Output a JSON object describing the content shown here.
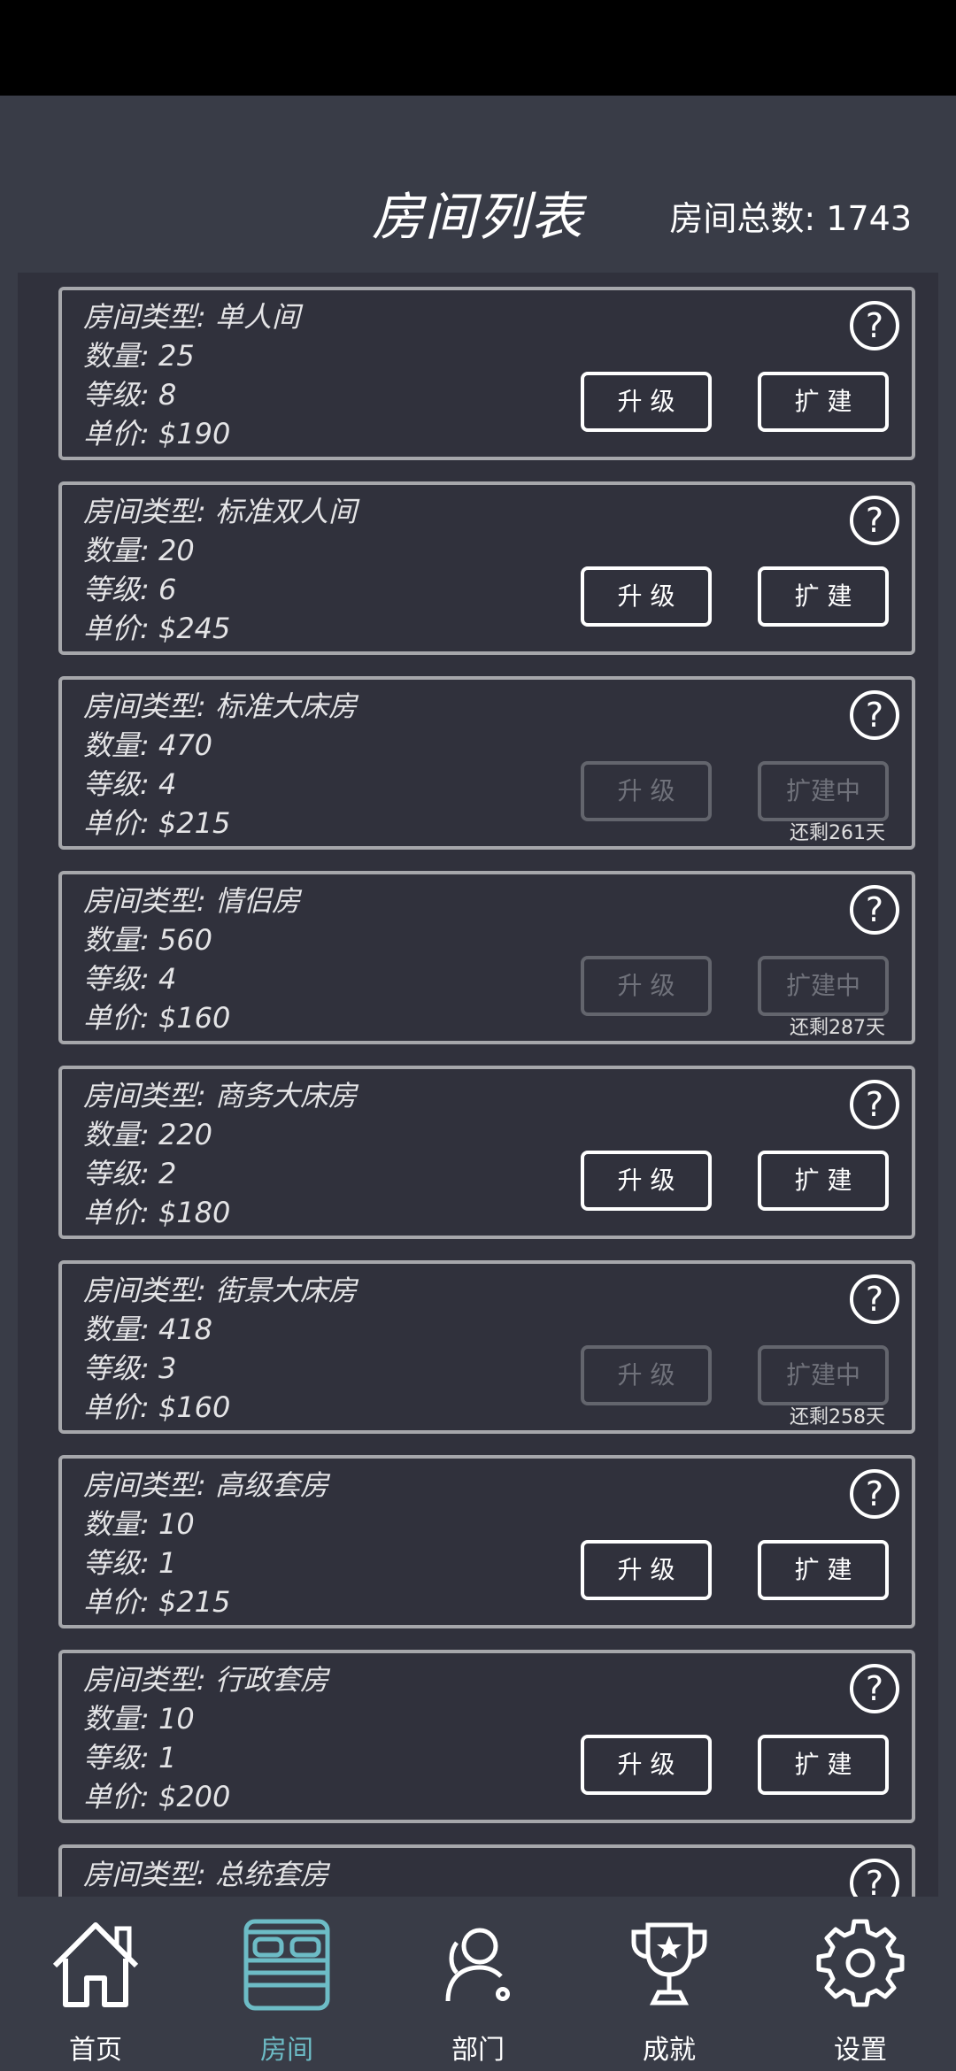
{
  "header": {
    "title": "房间列表",
    "total_label": "房间总数: 1743"
  },
  "buttons": {
    "upgrade": "升 级",
    "expand": "扩 建",
    "expanding": "扩建中",
    "help": "?"
  },
  "rooms": [
    {
      "type": "房间类型: 单人间",
      "count": "数量: 25",
      "level": "等级: 8",
      "price": "单价: $190",
      "state": "active",
      "remaining": ""
    },
    {
      "type": "房间类型: 标准双人间",
      "count": "数量: 20",
      "level": "等级: 6",
      "price": "单价: $245",
      "state": "active",
      "remaining": ""
    },
    {
      "type": "房间类型: 标准大床房",
      "count": "数量: 470",
      "level": "等级: 4",
      "price": "单价: $215",
      "state": "building",
      "remaining": "还剩261天"
    },
    {
      "type": "房间类型: 情侣房",
      "count": "数量: 560",
      "level": "等级: 4",
      "price": "单价: $160",
      "state": "building",
      "remaining": "还剩287天"
    },
    {
      "type": "房间类型: 商务大床房",
      "count": "数量: 220",
      "level": "等级: 2",
      "price": "单价: $180",
      "state": "active",
      "remaining": ""
    },
    {
      "type": "房间类型: 街景大床房",
      "count": "数量: 418",
      "level": "等级: 3",
      "price": "单价: $160",
      "state": "building",
      "remaining": "还剩258天"
    },
    {
      "type": "房间类型: 高级套房",
      "count": "数量: 10",
      "level": "等级: 1",
      "price": "单价: $215",
      "state": "active",
      "remaining": ""
    },
    {
      "type": "房间类型: 行政套房",
      "count": "数量: 10",
      "level": "等级: 1",
      "price": "单价: $200",
      "state": "active",
      "remaining": ""
    },
    {
      "type": "房间类型: 总统套房",
      "count": "",
      "level": "",
      "price": "",
      "state": "active",
      "remaining": ""
    }
  ],
  "nav": {
    "home": "首页",
    "rooms": "房间",
    "departments": "部门",
    "achievements": "成就",
    "settings": "设置",
    "active_color": "#6dbcc6"
  }
}
